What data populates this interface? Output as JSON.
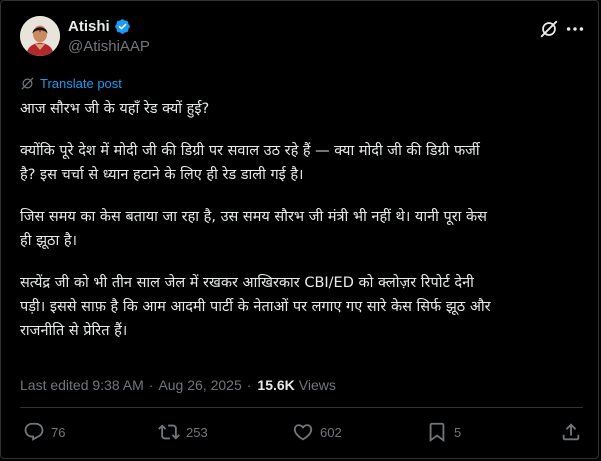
{
  "author": {
    "name": "Atishi",
    "handle": "@AtishiAAP"
  },
  "translate_label": "Translate post",
  "paragraphs": [
    [
      "आज सौरभ जी के यहाँ रेड क्यों हुई?"
    ],
    [
      "क्योंकि पूरे देश में मोदी जी की डिग्री पर सवाल उठ रहे हैं — क्या मोदी जी की डिग्री फर्जी",
      "है? इस चर्चा से ध्यान हटाने के लिए ही रेड डाली गई है।"
    ],
    [
      "जिस समय का केस बताया जा रहा है, उस समय सौरभ जी मंत्री भी नहीं थे। यानी पूरा केस",
      "ही झूठा है।"
    ],
    [
      "सत्येंद्र जी को भी तीन साल जेल में रखकर आखिरकार CBI/ED को क्लोज़र रिपोर्ट देनी",
      "पड़ी। इससे साफ़ है कि आम आदमी पार्टी के नेताओं पर लगाए गए सारे केस सिर्फ झूठ और",
      "राजनीति से प्रेरित हैं।"
    ]
  ],
  "meta": {
    "edited": "Last edited 9:38 AM",
    "separator": "·",
    "date": "Aug 26, 2025",
    "views_count": "15.6K",
    "views_label": "Views"
  },
  "actions": {
    "replies": "76",
    "reposts": "253",
    "likes": "602",
    "bookmarks": "5"
  },
  "colors": {
    "background": "#000000",
    "text": "#e7e9ea",
    "secondary": "#71767b",
    "link": "#1d9bf0",
    "border": "#2f3336",
    "verified": "#1d9bf0"
  },
  "icons": [
    "verified-badge-icon",
    "grok-icon",
    "more-options-icon",
    "translate-icon",
    "reply-icon",
    "repost-icon",
    "like-icon",
    "bookmark-icon",
    "share-icon"
  ]
}
